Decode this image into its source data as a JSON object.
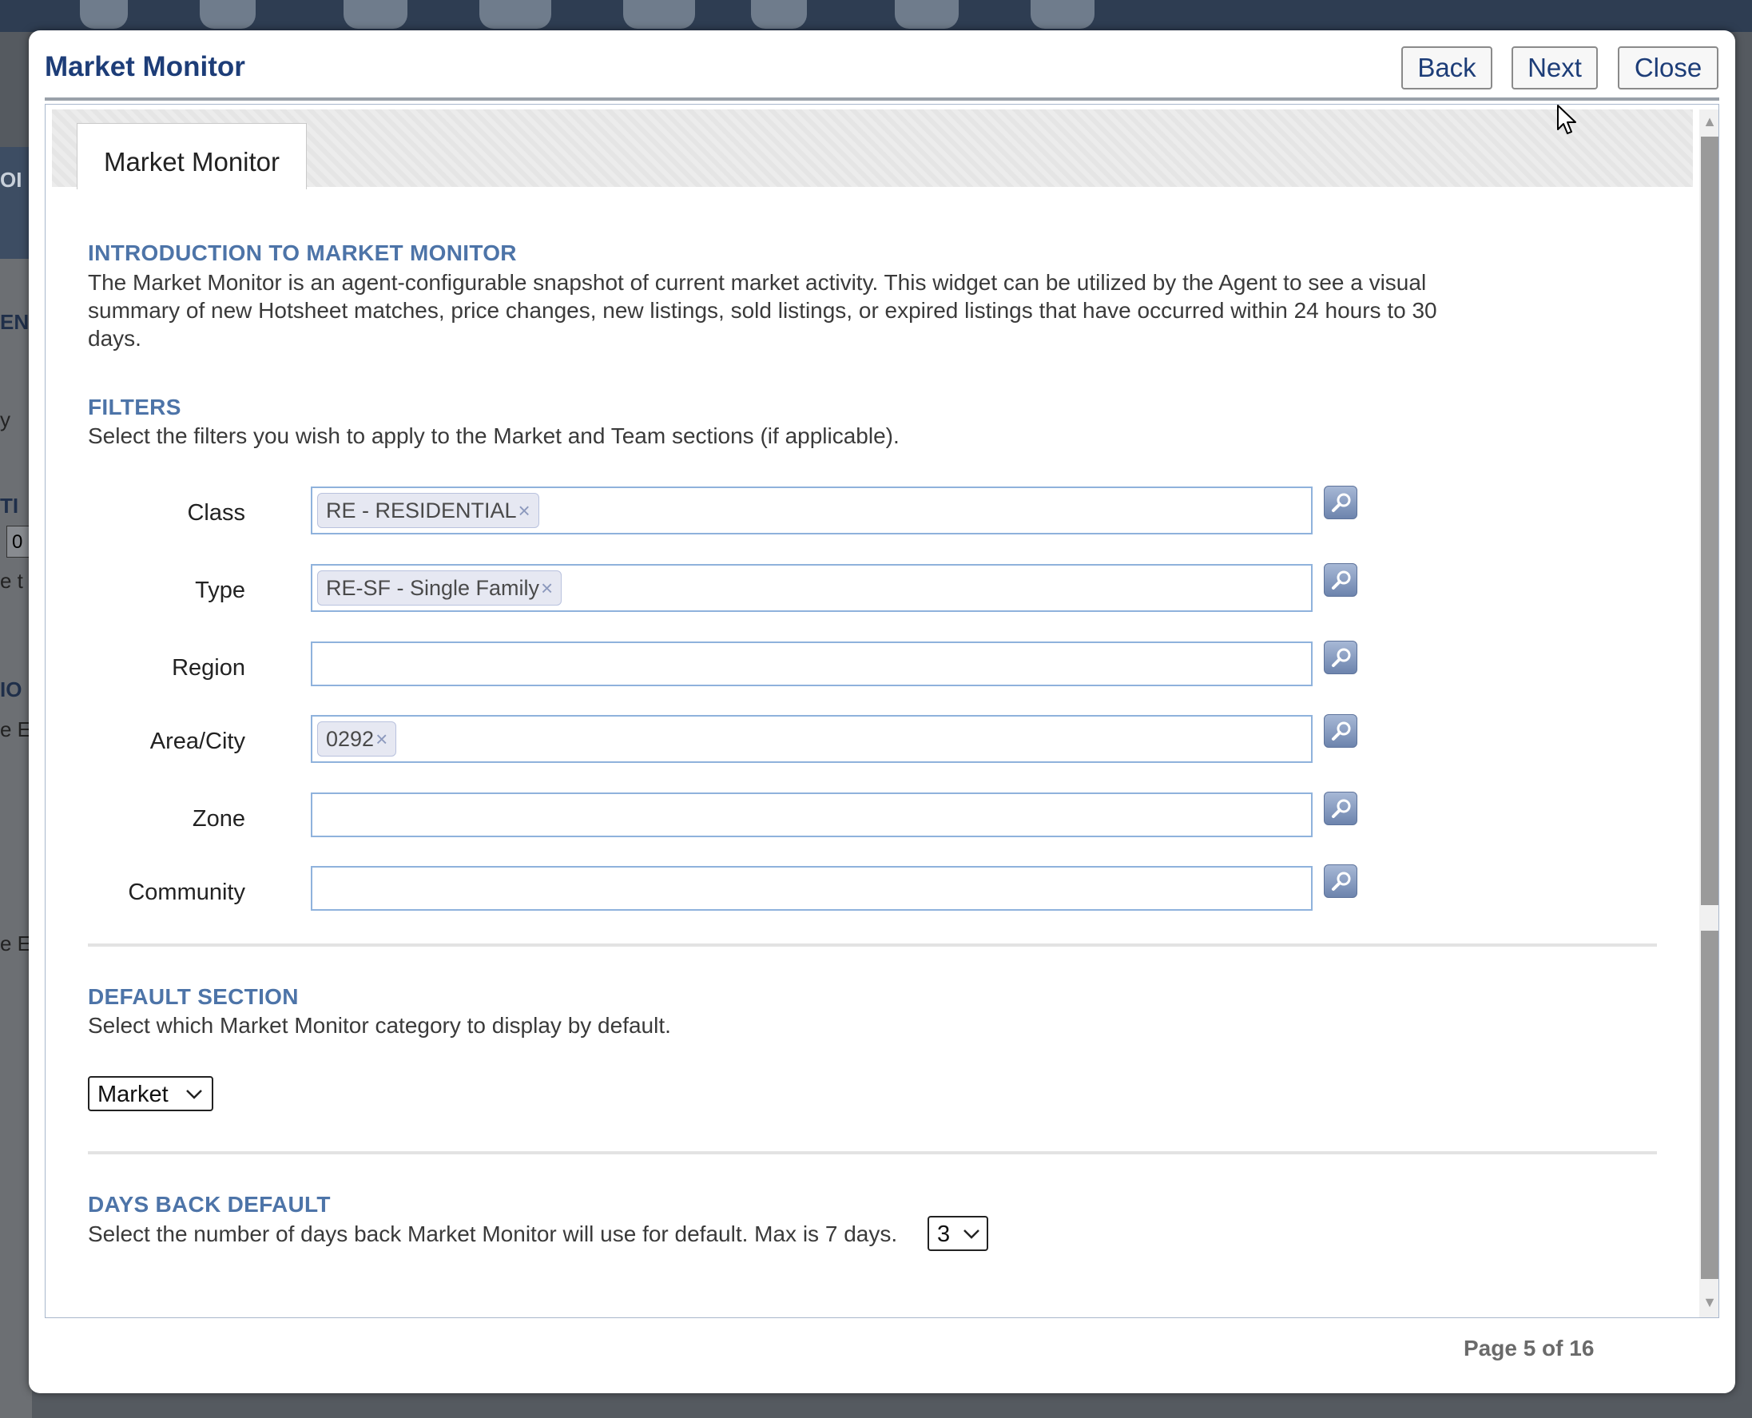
{
  "dialog": {
    "title": "Market Monitor",
    "buttons": {
      "back": "Back",
      "next": "Next",
      "close": "Close"
    },
    "tab": "Market Monitor",
    "page_info": "Page 5 of 16"
  },
  "intro": {
    "title": "INTRODUCTION TO MARKET MONITOR",
    "line1": "The Market Monitor is an agent-configurable snapshot of current market activity. This widget can be utilized by the Agent to see a visual",
    "line2": "summary of new Hotsheet matches, price changes, new listings, sold listings, or expired listings that have occurred within 24 hours to 30",
    "line3": "days."
  },
  "filters": {
    "title": "FILTERS",
    "description": "Select the filters you wish to apply to the Market and Team sections (if applicable).",
    "fields": [
      {
        "label": "Class",
        "chip": "RE - RESIDENTIAL"
      },
      {
        "label": "Type",
        "chip": "RE-SF - Single Family"
      },
      {
        "label": "Region"
      },
      {
        "label": "Area/City",
        "chip": "0292"
      },
      {
        "label": "Zone"
      },
      {
        "label": "Community"
      }
    ],
    "chip_remove": "×"
  },
  "default_section": {
    "title": "DEFAULT SECTION",
    "description": "Select which Market Monitor category to display by default.",
    "selected": "Market"
  },
  "days_back": {
    "title": "DAYS BACK DEFAULT",
    "description": "Select the number of days back Market Monitor will use for default. Max is 7 days.",
    "selected": "3"
  },
  "background": {
    "fragments": [
      "EN",
      "y",
      "TI",
      "0",
      "e t",
      "IO",
      "e E",
      "e E",
      "OI"
    ]
  },
  "icons": {
    "lookup": "magnifier-icon",
    "dropdown": "chevron-down-icon",
    "remove": "close-icon",
    "cursor": "mouse-pointer-icon"
  },
  "colors": {
    "title": "#1d3d78",
    "section": "#4d74a8",
    "input_border": "#8fb2dc"
  }
}
